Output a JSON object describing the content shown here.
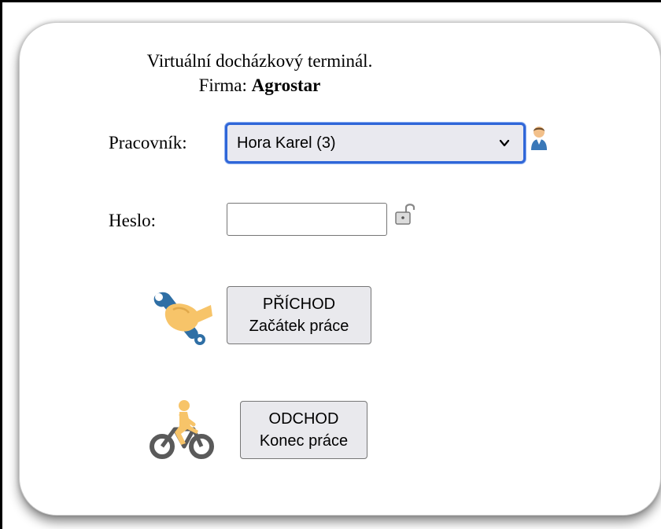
{
  "header": {
    "title_line1": "Virtuální docházkový terminál.",
    "firm_label": "Firma:",
    "firm_name": "Agrostar"
  },
  "form": {
    "worker_label": "Pracovník:",
    "worker_selected": "Hora Karel (3)",
    "password_label": "Heslo:",
    "password_value": ""
  },
  "actions": {
    "arrival_line1": "PŘÍCHOD",
    "arrival_line2": "Začátek práce",
    "departure_line1": "ODCHOD",
    "departure_line2": "Konec práce"
  },
  "icons": {
    "user": "user-icon",
    "lock": "unlocked-padlock-icon",
    "arrival": "hand-with-wrench-icon",
    "departure": "cyclist-icon"
  },
  "colors": {
    "select_focus_border": "#2f66d8",
    "skin": "#f7c469",
    "wrench": "#2f6fa5",
    "bike": "#5a5a5a"
  }
}
